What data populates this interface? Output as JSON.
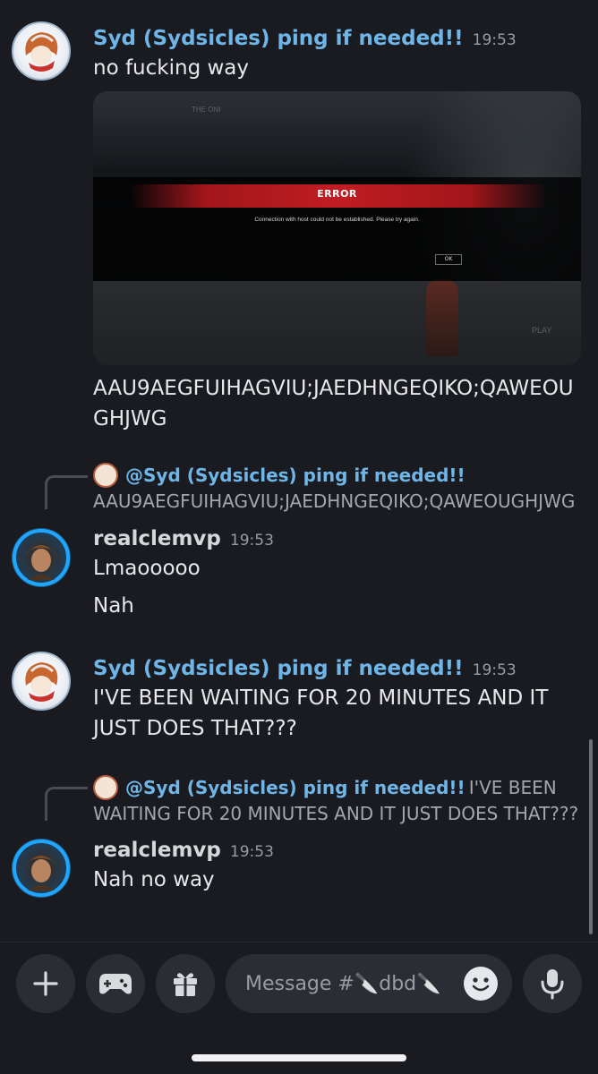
{
  "channel": {
    "name": "🔪dbd🔪"
  },
  "messages": [
    {
      "author": "Syd (Sydsicles) ping if needed!!",
      "time": "19:53",
      "lines": [
        "no fucking way"
      ],
      "attachment": {
        "hud_name": "THE ONI",
        "dialog_title": "ERROR",
        "dialog_message": "Connection with host could not be established. Please try again.",
        "dialog_button": "OK",
        "hud_play": "PLAY"
      },
      "after_lines": [
        "AAU9AEGFUIHAGVIU;JAEDHNGEQIKO;QAWEOU",
        "GHJWG"
      ]
    },
    {
      "reply_to": {
        "mention": "@Syd (Sydsicles) ping if needed!!",
        "snippet": "AAU9AEGFUIHAGVIU;JAEDHNGEQIKO;QAWEOUGHJWG"
      },
      "author": "realclemvp",
      "time": "19:53",
      "lines": [
        "Lmaooooo",
        "Nah"
      ]
    },
    {
      "author": "Syd (Sydsicles) ping if needed!!",
      "time": "19:53",
      "lines": [
        "I'VE BEEN WAITING FOR 20 MINUTES AND IT",
        "JUST DOES THAT???"
      ]
    },
    {
      "reply_to": {
        "mention": "@Syd (Sydsicles) ping if needed!!",
        "snippet_line1": "I'VE BEEN",
        "snippet_line2": "WAITING FOR 20 MINUTES AND IT JUST DOES THAT???"
      },
      "author": "realclemvp",
      "time": "19:53",
      "lines": [
        "Nah no way"
      ]
    }
  ],
  "composer": {
    "placeholder": "Message #🔪dbd🔪",
    "buttons": [
      "plus-icon",
      "gamepad-icon",
      "gift-icon",
      "emoji-icon",
      "microphone-icon"
    ]
  },
  "colors": {
    "background": "#1a1b20",
    "syd_name": "#6fb6e8",
    "input_bg": "#2b2d35"
  }
}
